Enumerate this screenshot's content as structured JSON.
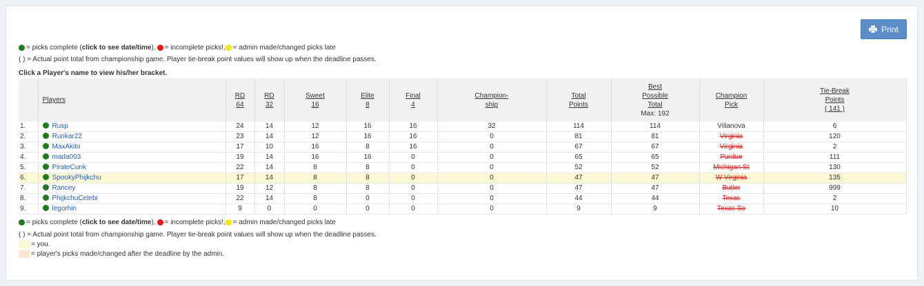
{
  "print_button": {
    "label": "Print",
    "icon": "printer-icon"
  },
  "legend_top": {
    "green_text": "= picks complete (",
    "green_bold": "click to see date/time",
    "green_after": "), ",
    "red_text": "= incomplete picks!, ",
    "yellow_text": "= admin made/changed picks late"
  },
  "paren_note": "( ) = Actual point total from championship game. Player tie-break point values will show up when the deadline passes.",
  "instruction": "Click a Player's name to view his/her bracket.",
  "columns": {
    "players": "Players",
    "rd64_a": "RD",
    "rd64_b": "64",
    "rd32_a": "RD",
    "rd32_b": "32",
    "sweet_a": "Sweet",
    "sweet_b": "16",
    "elite_a": "Elite",
    "elite_b": "8",
    "final_a": "Final",
    "final_b": "4",
    "champ_a": "Champion-",
    "champ_b": "ship",
    "total_a": "Total",
    "total_b": "Points",
    "best_a": "Best",
    "best_b": "Possible",
    "best_c": "Total",
    "best_max": "Max: 192",
    "pick_a": "Champion",
    "pick_b": "Pick",
    "tb_a": "Tie-Break",
    "tb_b": "Points",
    "tb_c": "( 141 )"
  },
  "rows": [
    {
      "rank": "1.",
      "name": "Rusp",
      "rd64": "24",
      "rd32": "14",
      "s16": "12",
      "e8": "16",
      "f4": "16",
      "ch": "32",
      "total": "114",
      "best": "114",
      "pick": "Villanova",
      "pick_out": false,
      "tb": "6"
    },
    {
      "rank": "2.",
      "name": "Rurikar22",
      "rd64": "23",
      "rd32": "14",
      "s16": "12",
      "e8": "16",
      "f4": "16",
      "ch": "0",
      "total": "81",
      "best": "81",
      "pick": "Virginia",
      "pick_out": true,
      "tb": "120"
    },
    {
      "rank": "3.",
      "name": "MaxAkito",
      "rd64": "17",
      "rd32": "10",
      "s16": "16",
      "e8": "8",
      "f4": "16",
      "ch": "0",
      "total": "67",
      "best": "67",
      "pick": "Virginia",
      "pick_out": true,
      "tb": "2"
    },
    {
      "rank": "4.",
      "name": "mada003",
      "rd64": "19",
      "rd32": "14",
      "s16": "16",
      "e8": "16",
      "f4": "0",
      "ch": "0",
      "total": "65",
      "best": "65",
      "pick": "Purdue",
      "pick_out": true,
      "tb": "111"
    },
    {
      "rank": "5.",
      "name": "PirateCunk",
      "rd64": "22",
      "rd32": "14",
      "s16": "8",
      "e8": "8",
      "f4": "0",
      "ch": "0",
      "total": "52",
      "best": "52",
      "pick": "Michigan St",
      "pick_out": true,
      "tb": "130"
    },
    {
      "rank": "6.",
      "name": "SpookyPhijkchu",
      "rd64": "17",
      "rd32": "14",
      "s16": "8",
      "e8": "8",
      "f4": "0",
      "ch": "0",
      "total": "47",
      "best": "47",
      "pick": "W Virginia",
      "pick_out": true,
      "tb": "135",
      "you": true
    },
    {
      "rank": "7.",
      "name": "Rancey",
      "rd64": "19",
      "rd32": "12",
      "s16": "8",
      "e8": "8",
      "f4": "0",
      "ch": "0",
      "total": "47",
      "best": "47",
      "pick": "Butler",
      "pick_out": true,
      "tb": "999"
    },
    {
      "rank": "8.",
      "name": "PhijkchuCelebi",
      "rd64": "22",
      "rd32": "14",
      "s16": "8",
      "e8": "0",
      "f4": "0",
      "ch": "0",
      "total": "44",
      "best": "44",
      "pick": "Texas",
      "pick_out": true,
      "tb": "2"
    },
    {
      "rank": "9.",
      "name": "legorhin",
      "rd64": "9",
      "rd32": "0",
      "s16": "0",
      "e8": "0",
      "f4": "0",
      "ch": "0",
      "total": "9",
      "best": "9",
      "pick": "Texas So",
      "pick_out": true,
      "tb": "10"
    }
  ],
  "legend_bottom": {
    "you_text": "= you.",
    "late_text": "= player's picks made/changed after the deadline by the admin."
  },
  "colors": {
    "complete": "#1f7a1f",
    "incomplete": "#e01b1b",
    "late": "#f2e800",
    "you_highlight": "#fbf9d3",
    "late_highlight": "#fde6cc",
    "accent": "#5b8ec7"
  }
}
